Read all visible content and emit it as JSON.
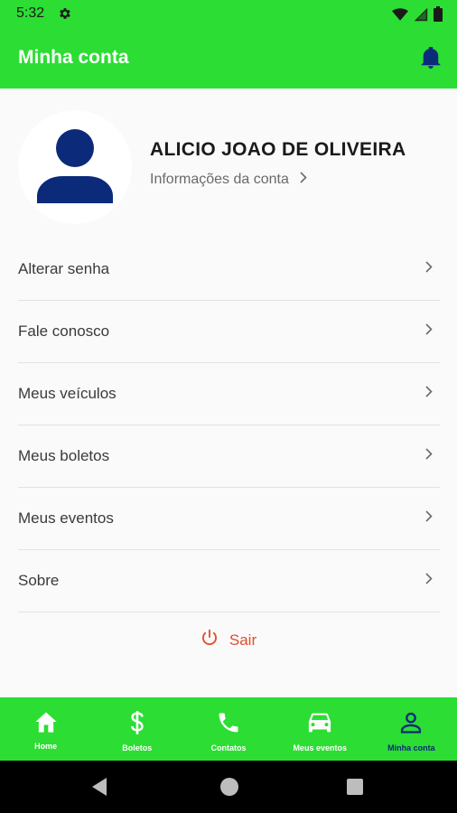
{
  "status_bar": {
    "time": "5:32"
  },
  "app_bar": {
    "title": "Minha conta"
  },
  "profile": {
    "name": "ALICIO JOAO DE OLIVEIRA",
    "info_link": "Informações da conta"
  },
  "menu": {
    "items": [
      {
        "label": "Alterar senha"
      },
      {
        "label": "Fale conosco"
      },
      {
        "label": "Meus veículos"
      },
      {
        "label": "Meus boletos"
      },
      {
        "label": "Meus eventos"
      },
      {
        "label": "Sobre"
      }
    ]
  },
  "logout": {
    "label": "Sair"
  },
  "bottom_nav": {
    "items": [
      {
        "label": "Home",
        "icon": "home-icon"
      },
      {
        "label": "Boletos",
        "icon": "dollar-icon"
      },
      {
        "label": "Contatos",
        "icon": "phone-icon"
      },
      {
        "label": "Meus eventos",
        "icon": "car-icon"
      },
      {
        "label": "Minha conta",
        "icon": "person-icon",
        "active": true
      }
    ]
  },
  "colors": {
    "primary": "#2cdd33",
    "avatar_blue": "#0b2a7a",
    "logout_red": "#e24c2c"
  }
}
